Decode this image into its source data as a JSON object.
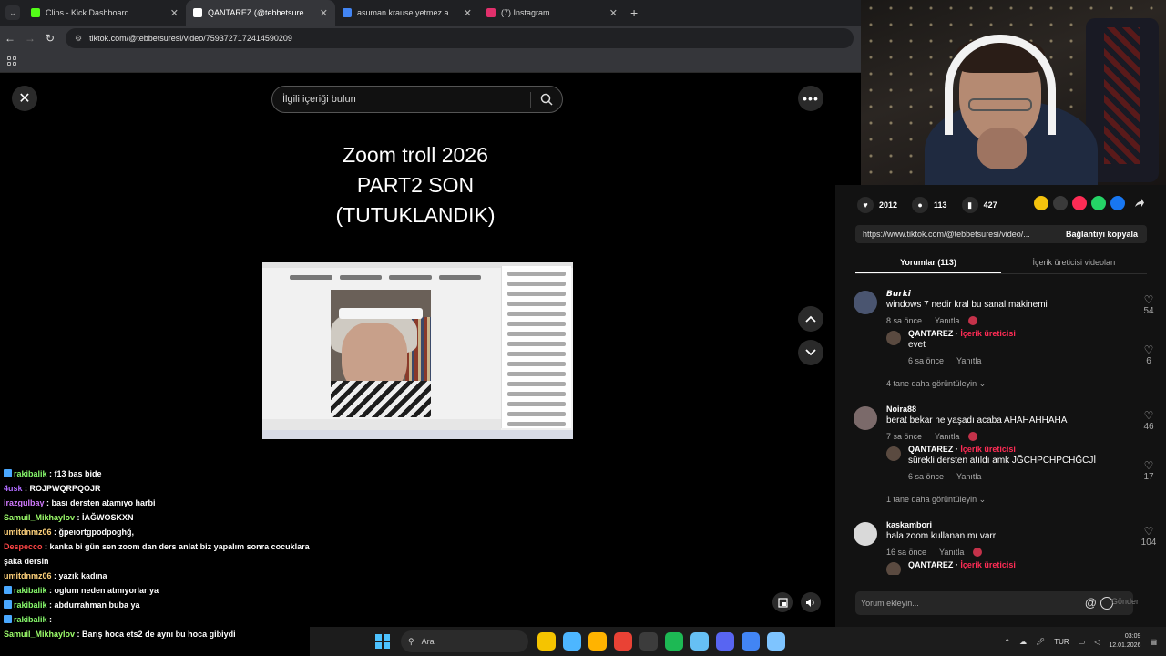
{
  "browser": {
    "tabs": [
      {
        "title": "Clips - Kick Dashboard",
        "favicon_color": "#53fc18",
        "active": false
      },
      {
        "title": "QANTAREZ (@tebbetsuresi) ...",
        "favicon_color": "#ffffff",
        "active": true
      },
      {
        "title": "asuman krause yetmez ama - G...",
        "favicon_color": "#4285f4",
        "active": false
      },
      {
        "title": "(7) Instagram",
        "favicon_color": "#e1306c",
        "active": false
      }
    ],
    "url": "tiktok.com/@tebbetsuresi/video/7593727172414590209"
  },
  "tiktok": {
    "search_placeholder": "İlgili içeriği bulun",
    "video_title_lines": [
      "Zoom troll 2026",
      "PART2 SON",
      "(TUTUKLANDIK)"
    ],
    "stats": {
      "likes": "2012",
      "comments": "113",
      "saves": "427"
    },
    "share_colors": [
      "#f4c20d",
      "#3a3a3a",
      "#fe2c55",
      "#25d366",
      "#1877f2"
    ],
    "link": "https://www.tiktok.com/@tebbetsuresi/video/...",
    "copy_label": "Bağlantıyı kopyala",
    "tab_comments": "Yorumlar (113)",
    "tab_creator": "İçerik üreticisi videoları",
    "reply_label": "Yanıtla",
    "creator_tag": "İçerik üreticisi",
    "comments": [
      {
        "user": "𝘽𝙪𝙧𝙠𝙞",
        "text": "windows 7 nedir kral bu sanal makinemi",
        "time": "8 sa önce",
        "likes": "54",
        "avatar": "#4a5570",
        "reply": {
          "user": "QANTAREZ",
          "text": "evet",
          "time": "6 sa önce",
          "likes": "6"
        },
        "more": "4 tane daha görüntüleyin"
      },
      {
        "user": "Noira88",
        "text": "berat bekar ne yaşadı acaba AHAHAHHAHA",
        "time": "7 sa önce",
        "likes": "46",
        "avatar": "#7b6a6a",
        "reply": {
          "user": "QANTAREZ",
          "text": "sürekli dersten atıldı amk JĞCHPCHPCHĞCJİ",
          "time": "6 sa önce",
          "likes": "17"
        },
        "more": "1 tane daha görüntüleyin"
      },
      {
        "user": "kaskambori",
        "text": "hala zoom kullanan mı varr",
        "time": "16 sa önce",
        "likes": "104",
        "avatar": "#d9d9d9",
        "reply": {
          "user": "QANTAREZ",
          "text": "",
          "time": "",
          "likes": ""
        },
        "more": ""
      }
    ],
    "add_comment_placeholder": "Yorum ekleyin...",
    "send_label": "Gönder"
  },
  "chat": [
    {
      "user": "rakibalik",
      "text": "f13 bas bide",
      "color": "#86f76b",
      "badge": true
    },
    {
      "user": "4usk",
      "text": "ROJPWQRPQOJR",
      "color": "#b06bff",
      "badge": false
    },
    {
      "user": "irazgulbay",
      "text": "bası dersten atamıyo harbi",
      "color": "#d27bff",
      "badge": false
    },
    {
      "user": "Samuil_Mikhaylov",
      "text": "İAĞWOSKXN",
      "color": "#9dff6b",
      "badge": false
    },
    {
      "user": "umitdnmz06",
      "text": "ğpeıortgpodpoghğ,",
      "color": "#ffd27b",
      "badge": false
    },
    {
      "user": "Despecco",
      "text": "kanka bi gün sen zoom dan ders anlat biz yapalım sonra cocuklara",
      "color": "#ff4646",
      "badge": false
    },
    {
      "user": "",
      "text": "şaka dersin",
      "color": "#ffffff",
      "badge": false
    },
    {
      "user": "umitdnmz06",
      "text": "yazık kadına",
      "color": "#ffd27b",
      "badge": false
    },
    {
      "user": "rakibalik",
      "text": "oglum neden atmıyorlar ya",
      "color": "#86f76b",
      "badge": true
    },
    {
      "user": "rakibalik",
      "text": "abdurrahman buba ya",
      "color": "#86f76b",
      "badge": true
    },
    {
      "user": "rakibalik",
      "text": "",
      "color": "#86f76b",
      "badge": true
    },
    {
      "user": "Samuil_Mikhaylov",
      "text": "Barış hoca ets2 de aynı bu hoca gibiydi",
      "color": "#9dff6b",
      "badge": false
    }
  ],
  "taskbar": {
    "search_label": "Ara",
    "language": "TUR",
    "time": "03:09",
    "date": "12.01.2026",
    "app_colors": [
      "#f5c400",
      "#4db6ff",
      "#ffb300",
      "#e94235",
      "#3c3c3c",
      "#1db954",
      "#66c0f4",
      "#5865f2",
      "#4285f4",
      "#7ec4ff"
    ]
  }
}
